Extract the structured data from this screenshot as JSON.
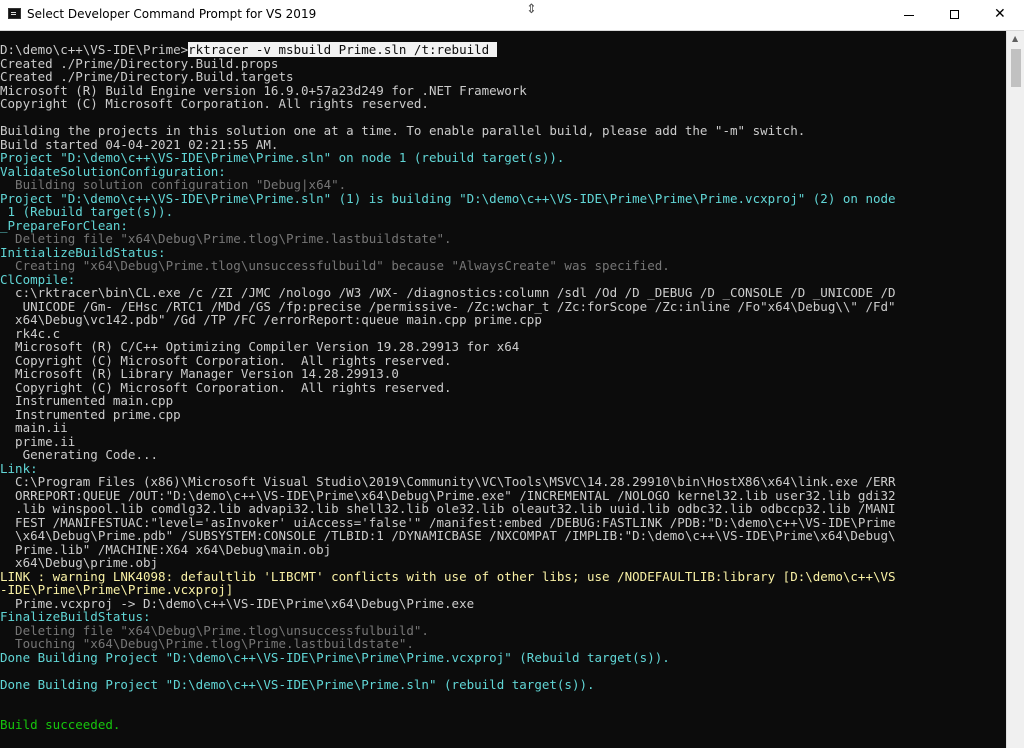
{
  "window": {
    "title": "Select Developer Command Prompt for VS 2019",
    "controls": {
      "minimize": "minimize",
      "maximize": "maximize",
      "close": "✕"
    },
    "cursor_glyph": "⇕"
  },
  "colors": {
    "background": "#0c0c0c",
    "default_text": "#cccccc",
    "cyan": "#61d6d6",
    "gray": "#767676",
    "yellow": "#f9f1a5",
    "green": "#16c60c"
  },
  "console": {
    "prompt": "D:\\demo\\c++\\VS-IDE\\Prime>",
    "command": "rktracer -v msbuild Prime.sln /t:rebuild ",
    "lines": [
      {
        "text": "Created ./Prime/Directory.Build.props",
        "color": "white"
      },
      {
        "text": "Created ./Prime/Directory.Build.targets",
        "color": "white"
      },
      {
        "text": "Microsoft (R) Build Engine version 16.9.0+57a23d249 for .NET Framework",
        "color": "white"
      },
      {
        "text": "Copyright (C) Microsoft Corporation. All rights reserved.",
        "color": "white"
      },
      {
        "text": "",
        "color": "white"
      },
      {
        "text": "Building the projects in this solution one at a time. To enable parallel build, please add the \"-m\" switch.",
        "color": "white"
      },
      {
        "text": "Build started 04-04-2021 02:21:55 AM.",
        "color": "white"
      },
      {
        "text": "Project \"D:\\demo\\c++\\VS-IDE\\Prime\\Prime.sln\" on node 1 (rebuild target(s)).",
        "color": "cyan"
      },
      {
        "text": "ValidateSolutionConfiguration:",
        "color": "cyan"
      },
      {
        "text": "  Building solution configuration \"Debug|x64\".",
        "color": "gray"
      },
      {
        "text": "Project \"D:\\demo\\c++\\VS-IDE\\Prime\\Prime.sln\" (1) is building \"D:\\demo\\c++\\VS-IDE\\Prime\\Prime\\Prime.vcxproj\" (2) on node",
        "color": "cyan"
      },
      {
        "text": " 1 (Rebuild target(s)).",
        "color": "cyan"
      },
      {
        "text": "_PrepareForClean:",
        "color": "cyan"
      },
      {
        "text": "  Deleting file \"x64\\Debug\\Prime.tlog\\Prime.lastbuildstate\".",
        "color": "gray"
      },
      {
        "text": "InitializeBuildStatus:",
        "color": "cyan"
      },
      {
        "text": "  Creating \"x64\\Debug\\Prime.tlog\\unsuccessfulbuild\" because \"AlwaysCreate\" was specified.",
        "color": "gray"
      },
      {
        "text": "ClCompile:",
        "color": "cyan"
      },
      {
        "text": "  c:\\rktracer\\bin\\CL.exe /c /ZI /JMC /nologo /W3 /WX- /diagnostics:column /sdl /Od /D _DEBUG /D _CONSOLE /D _UNICODE /D",
        "color": "white"
      },
      {
        "text": "   UNICODE /Gm- /EHsc /RTC1 /MDd /GS /fp:precise /permissive- /Zc:wchar_t /Zc:forScope /Zc:inline /Fo\"x64\\Debug\\\\\" /Fd\"",
        "color": "white"
      },
      {
        "text": "  x64\\Debug\\vc142.pdb\" /Gd /TP /FC /errorReport:queue main.cpp prime.cpp",
        "color": "white"
      },
      {
        "text": "  rk4c.c",
        "color": "white"
      },
      {
        "text": "  Microsoft (R) C/C++ Optimizing Compiler Version 19.28.29913 for x64",
        "color": "white"
      },
      {
        "text": "  Copyright (C) Microsoft Corporation.  All rights reserved.",
        "color": "white"
      },
      {
        "text": "  Microsoft (R) Library Manager Version 14.28.29913.0",
        "color": "white"
      },
      {
        "text": "  Copyright (C) Microsoft Corporation.  All rights reserved.",
        "color": "white"
      },
      {
        "text": "  Instrumented main.cpp",
        "color": "white"
      },
      {
        "text": "  Instrumented prime.cpp",
        "color": "white"
      },
      {
        "text": "  main.ii",
        "color": "white"
      },
      {
        "text": "  prime.ii",
        "color": "white"
      },
      {
        "text": "   Generating Code...",
        "color": "white"
      },
      {
        "text": "Link:",
        "color": "cyan"
      },
      {
        "text": "  C:\\Program Files (x86)\\Microsoft Visual Studio\\2019\\Community\\VC\\Tools\\MSVC\\14.28.29910\\bin\\HostX86\\x64\\link.exe /ERR",
        "color": "white"
      },
      {
        "text": "  ORREPORT:QUEUE /OUT:\"D:\\demo\\c++\\VS-IDE\\Prime\\x64\\Debug\\Prime.exe\" /INCREMENTAL /NOLOGO kernel32.lib user32.lib gdi32",
        "color": "white"
      },
      {
        "text": "  .lib winspool.lib comdlg32.lib advapi32.lib shell32.lib ole32.lib oleaut32.lib uuid.lib odbc32.lib odbccp32.lib /MANI",
        "color": "white"
      },
      {
        "text": "  FEST /MANIFESTUAC:\"level='asInvoker' uiAccess='false'\" /manifest:embed /DEBUG:FASTLINK /PDB:\"D:\\demo\\c++\\VS-IDE\\Prime",
        "color": "white"
      },
      {
        "text": "  \\x64\\Debug\\Prime.pdb\" /SUBSYSTEM:CONSOLE /TLBID:1 /DYNAMICBASE /NXCOMPAT /IMPLIB:\"D:\\demo\\c++\\VS-IDE\\Prime\\x64\\Debug\\",
        "color": "white"
      },
      {
        "text": "  Prime.lib\" /MACHINE:X64 x64\\Debug\\main.obj",
        "color": "white"
      },
      {
        "text": "  x64\\Debug\\prime.obj",
        "color": "white"
      },
      {
        "text": "LINK : warning LNK4098: defaultlib 'LIBCMT' conflicts with use of other libs; use /NODEFAULTLIB:library [D:\\demo\\c++\\VS",
        "color": "yellow"
      },
      {
        "text": "-IDE\\Prime\\Prime\\Prime.vcxproj]",
        "color": "yellow"
      },
      {
        "text": "  Prime.vcxproj -> D:\\demo\\c++\\VS-IDE\\Prime\\x64\\Debug\\Prime.exe",
        "color": "white"
      },
      {
        "text": "FinalizeBuildStatus:",
        "color": "cyan"
      },
      {
        "text": "  Deleting file \"x64\\Debug\\Prime.tlog\\unsuccessfulbuild\".",
        "color": "gray"
      },
      {
        "text": "  Touching \"x64\\Debug\\Prime.tlog\\Prime.lastbuildstate\".",
        "color": "gray"
      },
      {
        "text": "Done Building Project \"D:\\demo\\c++\\VS-IDE\\Prime\\Prime\\Prime.vcxproj\" (Rebuild target(s)).",
        "color": "cyan"
      },
      {
        "text": "",
        "color": "white"
      },
      {
        "text": "Done Building Project \"D:\\demo\\c++\\VS-IDE\\Prime\\Prime.sln\" (rebuild target(s)).",
        "color": "cyan"
      },
      {
        "text": "",
        "color": "white"
      },
      {
        "text": "",
        "color": "white"
      },
      {
        "text": "Build succeeded.",
        "color": "green"
      }
    ]
  },
  "scrollbar": {
    "up_arrow": "▲"
  }
}
